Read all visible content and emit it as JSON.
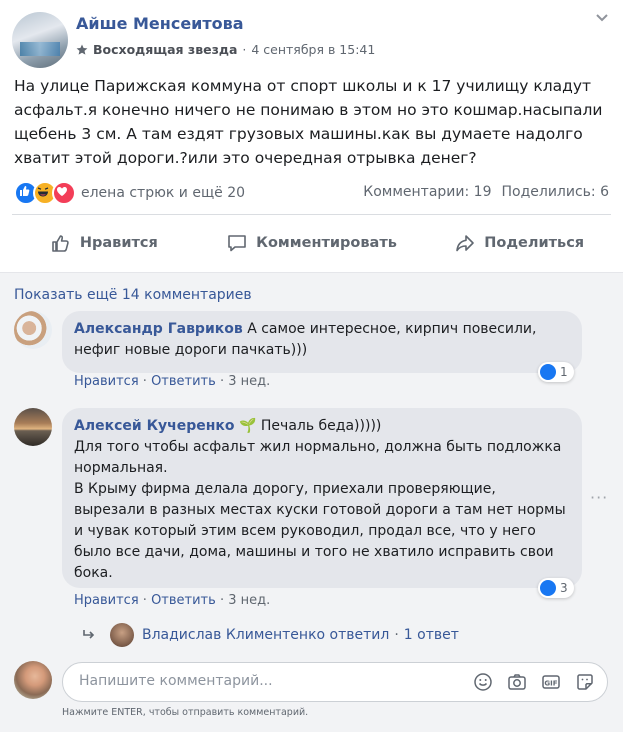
{
  "post": {
    "author": "Айше Менсеитова",
    "badge": "Восходящая звезда",
    "separator": "·",
    "date": "4 сентября в 15:41",
    "text": "На улице Парижская коммуна от спорт школы и к 17 училищу кладут асфальт.я конечно ничего не понимаю в этом но это кошмар.насыпали щебень 3 см. А там ездят грузовых машины.как вы думаете надолго хватит этой дороги.?или это очередная отрывка денег?",
    "reactions_names": "елена стрюк и ещё 20",
    "comments_count": "Комментарии: 19",
    "shares_count": "Поделились: 6"
  },
  "actions": {
    "like": "Нравится",
    "comment": "Комментировать",
    "share": "Поделиться"
  },
  "comments_section": {
    "show_more": "Показать ещё 14 комментариев",
    "comments": [
      {
        "name": "Александр Гавриков",
        "text": "А самое интересное, кирпич повесили, нефиг новые дороги пачкать)))",
        "like": "Нравится",
        "reply": "Ответить",
        "ago": "3 нед.",
        "reactions": "1"
      },
      {
        "name": "Алексей Кучеренко",
        "name_suffix": "Печаль беда)))))",
        "text": "Для того чтобы асфальт жил нормально, должна быть подложка нормальная.\nВ Крыму фирма делала дорогу, приехали проверяющие, вырезали в разных местах куски готовой дороги а там нет нормы и чувак который этим всем руководил, продал все, что у него было все дачи, дома, машины и того не хватило исправить свои бока.",
        "like": "Нравится",
        "reply": "Ответить",
        "ago": "3 нед.",
        "reactions": "3"
      }
    ],
    "reply_summary": {
      "name": "Владислав Климентенко ответил",
      "count": "1 ответ"
    }
  },
  "composer": {
    "placeholder": "Напишите комментарий...",
    "hint": "Нажмите ENTER, чтобы отправить комментарий."
  },
  "icons": [
    "star-icon",
    "chevron-down-icon",
    "like-reaction-icon",
    "haha-reaction-icon",
    "love-reaction-icon",
    "thumbs-up-icon",
    "comment-icon",
    "share-icon",
    "more-dots-icon",
    "reply-arrow-icon",
    "emoji-icon",
    "camera-icon",
    "gif-icon",
    "sticker-icon"
  ],
  "colors": {
    "link": "#385898",
    "like_blue": "#1877f2",
    "secondary_text": "#606770",
    "bubble": "#e4e6eb"
  }
}
